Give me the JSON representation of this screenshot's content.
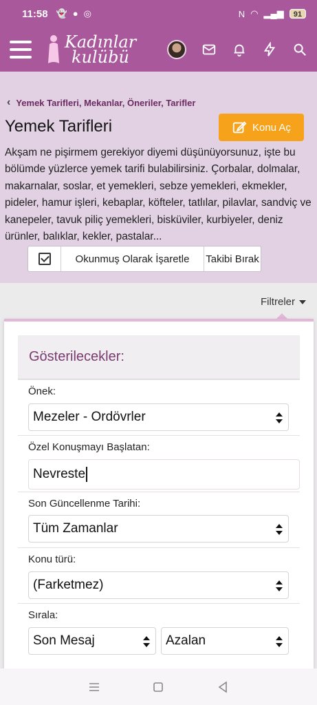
{
  "status_bar": {
    "time": "11:58",
    "battery": "91"
  },
  "header": {
    "logo_text_line1": "Kadınlar",
    "logo_text_line2": "kulübü"
  },
  "breadcrumb": {
    "label": "Yemek Tarifleri, Mekanlar, Öneriler, Tarifler"
  },
  "page": {
    "title": "Yemek Tarifleri",
    "new_topic_label": "Konu Aç",
    "description": "Akşam ne pişirmem gerekiyor diyemi düşünüyorsunuz, işte bu bölümde yüzlerce yemek tarifi bulabilirsiniz. Çorbalar, dolmalar, makarnalar, soslar, et yemekleri, sebze yemekleri, ekmekler, pideler, hamur işleri, kebaplar, köfteler, tatlılar, pilavlar, sandviç ve kanepeler, tavuk piliç yemekleri, bisküviler, kurbiyeler, deniz ürünler, balıklar, kekler, pastalar..."
  },
  "actions": {
    "mark_read_label": "Okunmuş Olarak İşaretle",
    "unfollow_label": "Takibi Bırak"
  },
  "filters": {
    "toggle_label": "Filtreler",
    "heading": "Gösterilecekler:",
    "prefix_label": "Önek:",
    "prefix_value": "Mezeler - Ordövrler",
    "started_by_label": "Özel Konuşmayı Başlatan:",
    "started_by_value": "Nevreste",
    "last_updated_label": "Son Güncellenme Tarihi:",
    "last_updated_value": "Tüm Zamanlar",
    "thread_type_label": "Konu türü:",
    "thread_type_value": "(Farketmez)",
    "sort_label": "Sırala:",
    "sort_value": "Son Mesaj",
    "order_value": "Azalan"
  },
  "colors": {
    "brand": "#a8589b",
    "info_bg": "#e1d1e3",
    "accent_button": "#f7a21b",
    "breadcrumb": "#6b2a62"
  }
}
